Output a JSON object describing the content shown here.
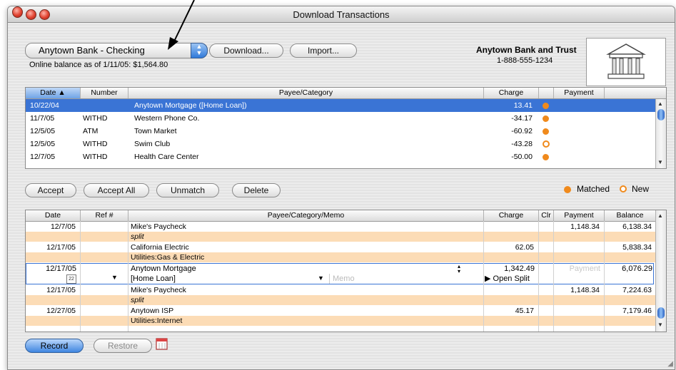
{
  "window": {
    "title": "Download Transactions"
  },
  "account_popup": {
    "selected": "Anytown Bank - Checking"
  },
  "buttons": {
    "download": "Download...",
    "import": "Import...",
    "accept": "Accept",
    "accept_all": "Accept All",
    "unmatch": "Unmatch",
    "delete": "Delete",
    "record": "Record",
    "restore": "Restore"
  },
  "online_balance": "Online balance as of 1/11/05: $1,564.80",
  "bank": {
    "name": "Anytown Bank and Trust",
    "phone": "1-888-555-1234"
  },
  "downloaded": {
    "columns": [
      "Date",
      "Number",
      "Payee/Category",
      "Charge",
      "",
      "Payment"
    ],
    "rows": [
      {
        "date": "10/22/04",
        "number": "",
        "payee": "Anytown Mortgage ([Home Loan])",
        "charge": "13.41",
        "status": "matched",
        "selected": true
      },
      {
        "date": "11/7/05",
        "number": "WITHD",
        "payee": "Western Phone Co.",
        "charge": "-34.17",
        "status": "matched"
      },
      {
        "date": "12/5/05",
        "number": "ATM",
        "payee": "Town Market",
        "charge": "-60.92",
        "status": "matched"
      },
      {
        "date": "12/5/05",
        "number": "WITHD",
        "payee": "Swim Club",
        "charge": "-43.28",
        "status": "new"
      },
      {
        "date": "12/7/05",
        "number": "WITHD",
        "payee": "Health Care Center",
        "charge": "-50.00",
        "status": "matched"
      }
    ]
  },
  "legend": {
    "matched": "Matched",
    "new": "New",
    "matched_color": "#f08a1c"
  },
  "register": {
    "columns": [
      "Date",
      "Ref #",
      "Payee/Category/Memo",
      "Charge",
      "Clr",
      "Payment",
      "Balance"
    ],
    "entries": [
      {
        "date": "12/7/05",
        "payee": "Mike's Paycheck",
        "category": "split",
        "charge": "",
        "payment": "1,148.34",
        "balance": "6,138.34"
      },
      {
        "date": "12/17/05",
        "payee": "California Electric",
        "category": "Utilities:Gas & Electric",
        "charge": "62.05",
        "payment": "",
        "balance": "5,838.34"
      },
      {
        "date": "12/17/05",
        "payee": "Anytown Mortgage",
        "category": "[Home Loan]",
        "charge": "1,342.49",
        "payment": "",
        "balance": "6,076.29",
        "editing": true,
        "memo_placeholder": "Memo",
        "payment_placeholder": "Payment",
        "open_split": "Open Split",
        "cal_day": "22"
      },
      {
        "date": "12/17/05",
        "payee": "Mike's Paycheck",
        "category": "split",
        "charge": "",
        "payment": "1,148.34",
        "balance": "7,224.63"
      },
      {
        "date": "12/27/05",
        "payee": "Anytown ISP",
        "category": "Utilities:Internet",
        "charge": "45.17",
        "payment": "",
        "balance": "7,179.46"
      }
    ]
  }
}
